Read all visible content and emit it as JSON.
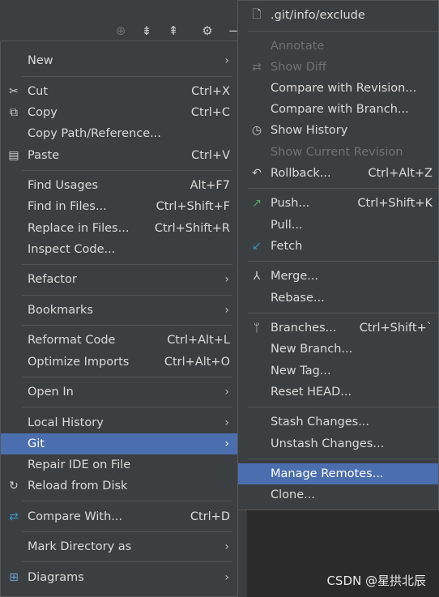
{
  "left_menu": {
    "new": "New",
    "cut": "Cut",
    "cut_sc": "Ctrl+X",
    "copy": "Copy",
    "copy_sc": "Ctrl+C",
    "copy_path": "Copy Path/Reference...",
    "paste": "Paste",
    "paste_sc": "Ctrl+V",
    "find_usages": "Find Usages",
    "find_usages_sc": "Alt+F7",
    "find_in_files": "Find in Files...",
    "find_in_files_sc": "Ctrl+Shift+F",
    "replace_in_files": "Replace in Files...",
    "replace_in_files_sc": "Ctrl+Shift+R",
    "inspect_code": "Inspect Code...",
    "refactor": "Refactor",
    "bookmarks": "Bookmarks",
    "reformat_code": "Reformat Code",
    "reformat_code_sc": "Ctrl+Alt+L",
    "optimize_imports": "Optimize Imports",
    "optimize_imports_sc": "Ctrl+Alt+O",
    "open_in": "Open In",
    "local_history": "Local History",
    "git": "Git",
    "repair_ide": "Repair IDE on File",
    "reload_from_disk": "Reload from Disk",
    "compare_with": "Compare With...",
    "compare_with_sc": "Ctrl+D",
    "mark_directory": "Mark Directory as",
    "diagrams": "Diagrams"
  },
  "git_menu": {
    "exclude": ".git/info/exclude",
    "annotate": "Annotate",
    "show_diff": "Show Diff",
    "compare_revision": "Compare with Revision...",
    "compare_branch": "Compare with Branch...",
    "show_history": "Show History",
    "show_current_revision": "Show Current Revision",
    "rollback": "Rollback...",
    "rollback_sc": "Ctrl+Alt+Z",
    "push": "Push...",
    "push_sc": "Ctrl+Shift+K",
    "pull": "Pull...",
    "fetch": "Fetch",
    "merge": "Merge...",
    "rebase": "Rebase...",
    "branches": "Branches...",
    "branches_sc": "Ctrl+Shift+`",
    "new_branch": "New Branch...",
    "new_tag": "New Tag...",
    "reset_head": "Reset HEAD...",
    "stash": "Stash Changes...",
    "unstash": "Unstash Changes...",
    "manage_remotes": "Manage Remotes...",
    "clone": "Clone..."
  },
  "watermark": "CSDN @星拱北辰",
  "colors": {
    "menu_bg": "#3c3f41",
    "selection": "#4b6eaf",
    "disabled": "#6f7274",
    "push_green": "#59a869",
    "fetch_blue": "#3592c4"
  }
}
